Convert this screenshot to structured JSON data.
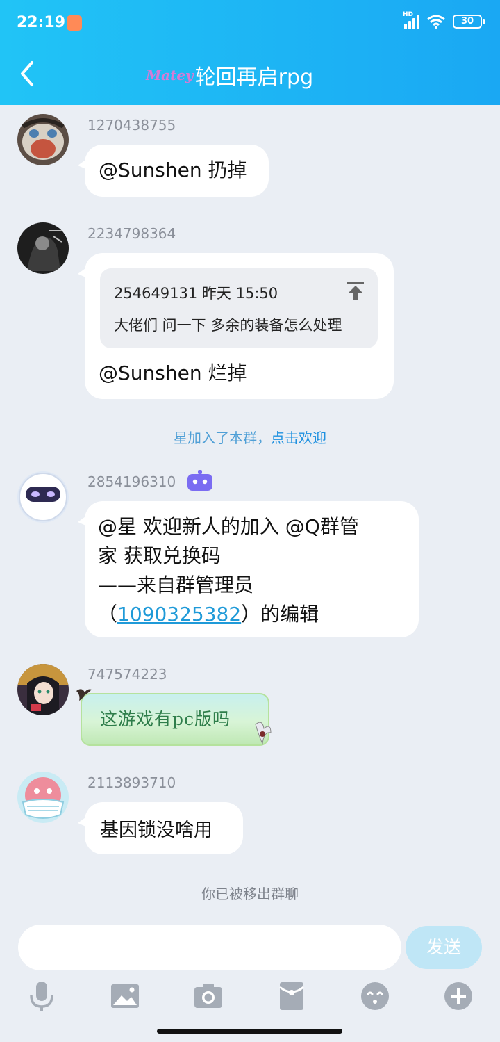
{
  "status_bar": {
    "time": "22:19",
    "network": "HD",
    "battery": "30"
  },
  "header": {
    "logo_text": "Matey",
    "title": "轮回再启rpg"
  },
  "messages": [
    {
      "sender": "1270438755",
      "text": "@Sunshen 扔掉"
    },
    {
      "sender": "2234798364",
      "quote": {
        "meta": "254649131 昨天 15:50",
        "text": "大佬们 问一下 多余的装备怎么处理"
      },
      "text": "@Sunshen 烂掉"
    },
    {
      "sender": "2854196310",
      "lines": [
        "@星 欢迎新人的加入 @Q群管",
        "家 获取兑换码",
        "——来自群管理员"
      ],
      "line4_prefix": "（",
      "link": "1090325382",
      "line4_suffix": "）的编辑"
    },
    {
      "sender": "747574223",
      "sticker_text": "这游戏有pc版吗"
    },
    {
      "sender": "2113893710",
      "text": "基因锁没啥用"
    }
  ],
  "system": {
    "join_text": "星加入了本群，",
    "join_link": "点击欢迎",
    "removed": "你已被移出群聊"
  },
  "input": {
    "placeholder": "",
    "send_label": "发送"
  },
  "toolbar_icons": [
    "microphone-icon",
    "image-icon",
    "camera-icon",
    "red-packet-icon",
    "emoji-icon",
    "plus-icon"
  ],
  "colors": {
    "header_start": "#21c4f6",
    "header_end": "#1aa8f3",
    "link": "#1f9ad8",
    "send_disabled": "#bfe6f6"
  }
}
